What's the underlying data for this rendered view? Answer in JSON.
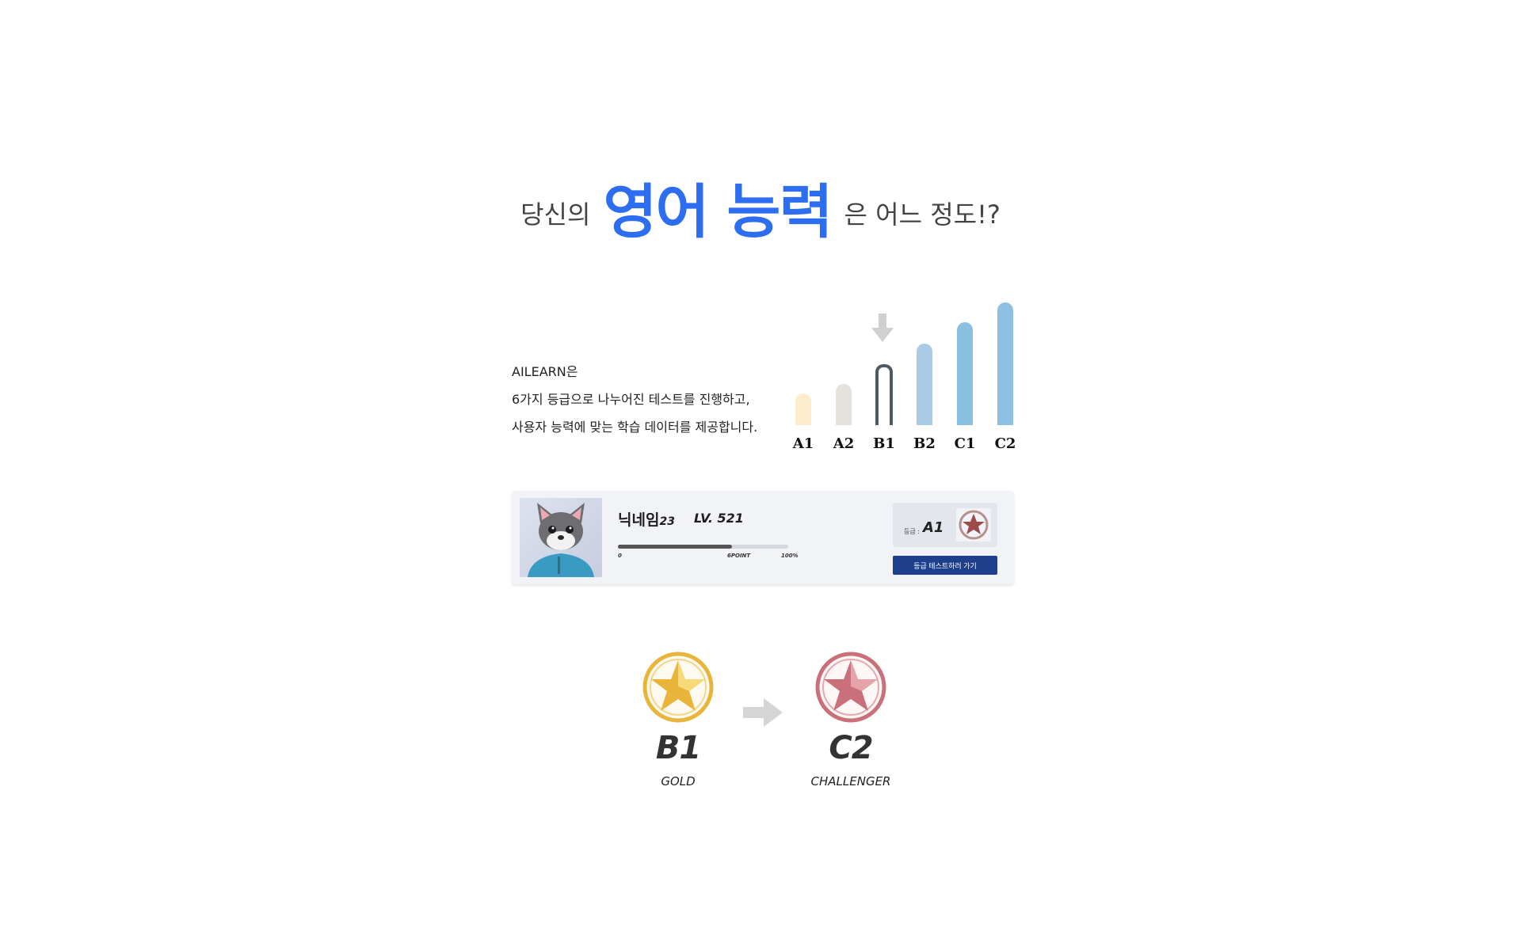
{
  "headline": {
    "prefix": "당신의",
    "highlight": "영어 능력",
    "suffix": "은 어느 정도!?",
    "highlight_color": "#2d6ef0"
  },
  "intro": {
    "lines": [
      "AILEARN은",
      "6가지 등급으로 나누어진 테스트를 진행하고,",
      "사용자 능력에 맞는 학습 데이터를 제공합니다."
    ]
  },
  "levels": {
    "items": [
      {
        "label": "A1",
        "rank": 1,
        "color": "#fdeccd"
      },
      {
        "label": "A2",
        "rank": 2,
        "color": "#e4e2dc"
      },
      {
        "label": "B1",
        "rank": 3,
        "color": "#ffffff",
        "current": true
      },
      {
        "label": "B2",
        "rank": 4,
        "color": "#a9cbe3"
      },
      {
        "label": "C1",
        "rank": 5,
        "color": "#8bbfe2"
      },
      {
        "label": "C2",
        "rank": 6,
        "color": "#8ec0e3"
      }
    ],
    "marker_icon": "down-arrow-icon"
  },
  "profile": {
    "nickname": "닉네임",
    "nickname_num": "23",
    "level": "LV. 521",
    "progress": {
      "start": "0",
      "mid": "6POINT",
      "end": "100%",
      "fraction": 0.67
    },
    "grade_label": "등급 :",
    "grade_value": "A1",
    "grade_button": "등급 테스트하러 가기",
    "avatar_icon": "cat-avatar-icon"
  },
  "progression": {
    "from": {
      "code": "B1",
      "name": "GOLD",
      "color": "#e8b53a"
    },
    "to": {
      "code": "C2",
      "name": "CHALLENGER",
      "color": "#c9707a"
    },
    "arrow_icon": "right-arrow-icon"
  }
}
